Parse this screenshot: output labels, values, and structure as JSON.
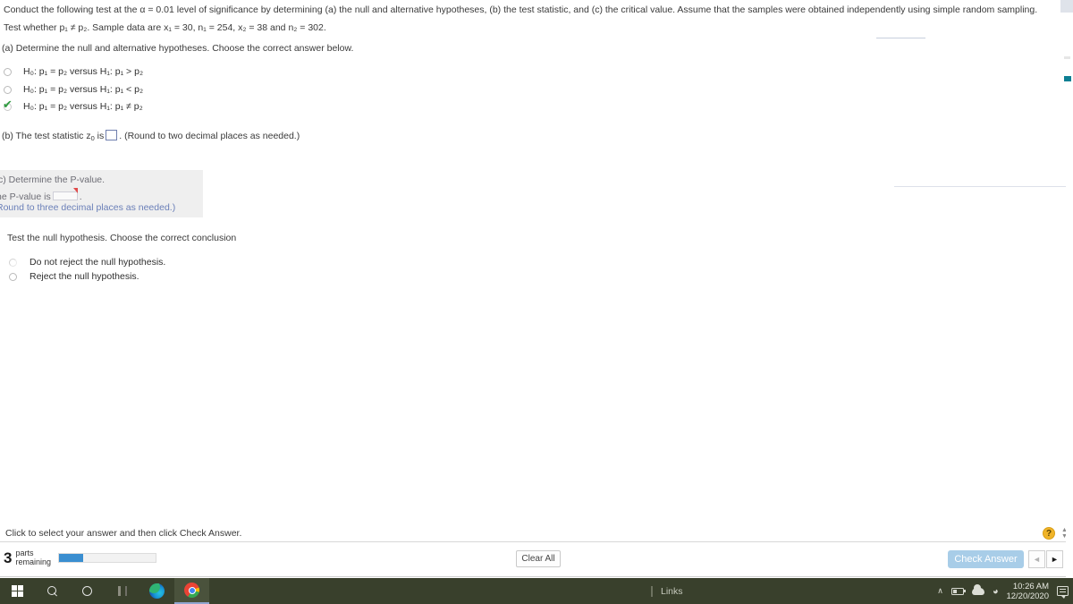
{
  "problem": {
    "intro": "Conduct the following test at the α = 0.01 level of significance by determining (a) the null and alternative hypotheses, (b) the test statistic, and (c) the critical value. Assume that the samples were obtained independently using simple random sampling.",
    "sample_line_pre": "Test whether p",
    "sample_line": "Test whether p₁ ≠ p₂. Sample data are x₁ = 30, n₁ = 254, x₂ = 38 and n₂ = 302.",
    "part_a_prompt": "(a) Determine the null and alternative hypotheses. Choose the correct answer below.",
    "options": [
      {
        "label": "H₀: p₁ = p₂ versus H₁: p₁ > p₂",
        "selected": false
      },
      {
        "label": "H₀: p₁ = p₂ versus H₁: p₁ < p₂",
        "selected": false
      },
      {
        "label": "H₀: p₁ = p₂ versus H₁: p₁ ≠ p₂",
        "selected": true
      }
    ],
    "part_b_pre": "(b) The test statistic z",
    "part_b_sub": "0",
    "part_b_mid": " is",
    "part_b_value": "",
    "part_b_post": ". (Round to two decimal places as needed.)",
    "conclusion_prompt": "Test the null hypothesis. Choose the correct conclusion",
    "conclusion_options": [
      {
        "label": "Do not reject the null hypothesis.",
        "selected": false
      },
      {
        "label": "Reject the null hypothesis.",
        "selected": false
      }
    ]
  },
  "grey_panel": {
    "heading": "c) Determine the P-value.",
    "pvalue_pre": "he P-value is",
    "pvalue_value": "",
    "pvalue_post": ".",
    "round_note": "Round to three decimal places as needed.)"
  },
  "footer": {
    "hint": "Click to select your answer and then click Check Answer.",
    "parts_count": "3",
    "parts_word_1": "parts",
    "parts_word_2": "remaining",
    "progress_percent": 25,
    "clear_all_label": "Clear All",
    "check_answer_label": "Check Answer",
    "prev_icon": "◄",
    "next_icon": "►",
    "help_label": "?",
    "spinner_up": "▲",
    "spinner_down": "▼"
  },
  "taskbar": {
    "start_name": "windows-start-icon",
    "search_name": "search-icon",
    "cortana_name": "cortana-icon",
    "taskview_name": "task-view-icon",
    "edge_name": "edge-icon",
    "chrome_name": "chrome-icon",
    "links_label": "Links",
    "tray_chevron": "∧",
    "wifi_glyph": "◠",
    "time": "10:26 AM",
    "date": "12/20/2020"
  },
  "colors": {
    "accent_blue": "#3a8ed0",
    "check_button": "#a8cde8",
    "check_green": "#2e9b3f",
    "grey_panel": "#efefef",
    "grey_panel_blue_text": "#6a7fb8",
    "taskbar": "#39402c",
    "help_yellow": "#f0b429",
    "scroll_thumb": "#0d7f93"
  }
}
